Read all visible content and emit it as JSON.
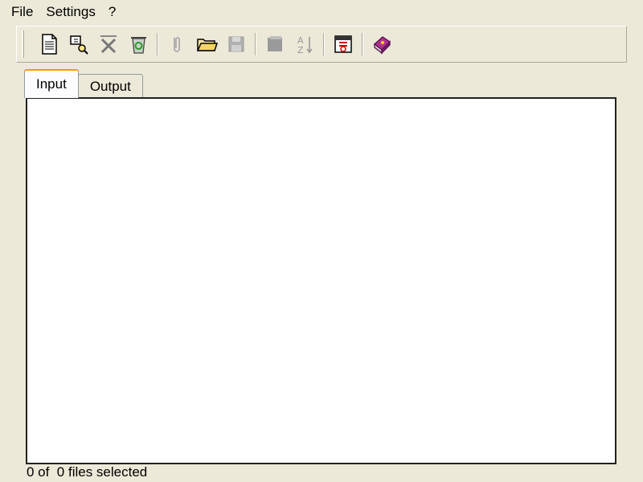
{
  "menu": {
    "file": "File",
    "settings": "Settings",
    "help": "?"
  },
  "toolbar": {
    "icons": [
      "new-document-icon",
      "find-icon",
      "remove-icon",
      "recycle-bin-icon",
      "attach-icon",
      "open-folder-icon",
      "save-icon",
      "copy-icon",
      "sort-icon",
      "calendar-icon",
      "help-book-icon"
    ]
  },
  "tabs": {
    "input": "Input",
    "output": "Output"
  },
  "status": {
    "text": "0 of  0 files selected"
  },
  "colors": {
    "background": "#ece9d8",
    "panel": "#ffffff",
    "tab_highlight": "#f0a000"
  }
}
